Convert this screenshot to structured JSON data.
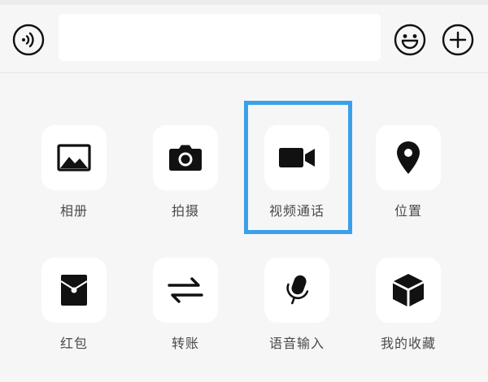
{
  "input_bar": {
    "message_value": "",
    "voice_icon": "voice-wave-icon",
    "emoji_icon": "smiley-icon",
    "plus_icon": "plus-circle-icon"
  },
  "panel": {
    "items": [
      {
        "label": "相册",
        "icon": "photo-album-icon"
      },
      {
        "label": "拍摄",
        "icon": "camera-icon"
      },
      {
        "label": "视频通话",
        "icon": "video-camera-icon"
      },
      {
        "label": "位置",
        "icon": "location-pin-icon"
      },
      {
        "label": "红包",
        "icon": "red-packet-icon"
      },
      {
        "label": "转账",
        "icon": "transfer-arrows-icon"
      },
      {
        "label": "语音输入",
        "icon": "microphone-icon"
      },
      {
        "label": "我的收藏",
        "icon": "favorites-cube-icon"
      }
    ],
    "highlight_color": "#3aa0ea"
  }
}
